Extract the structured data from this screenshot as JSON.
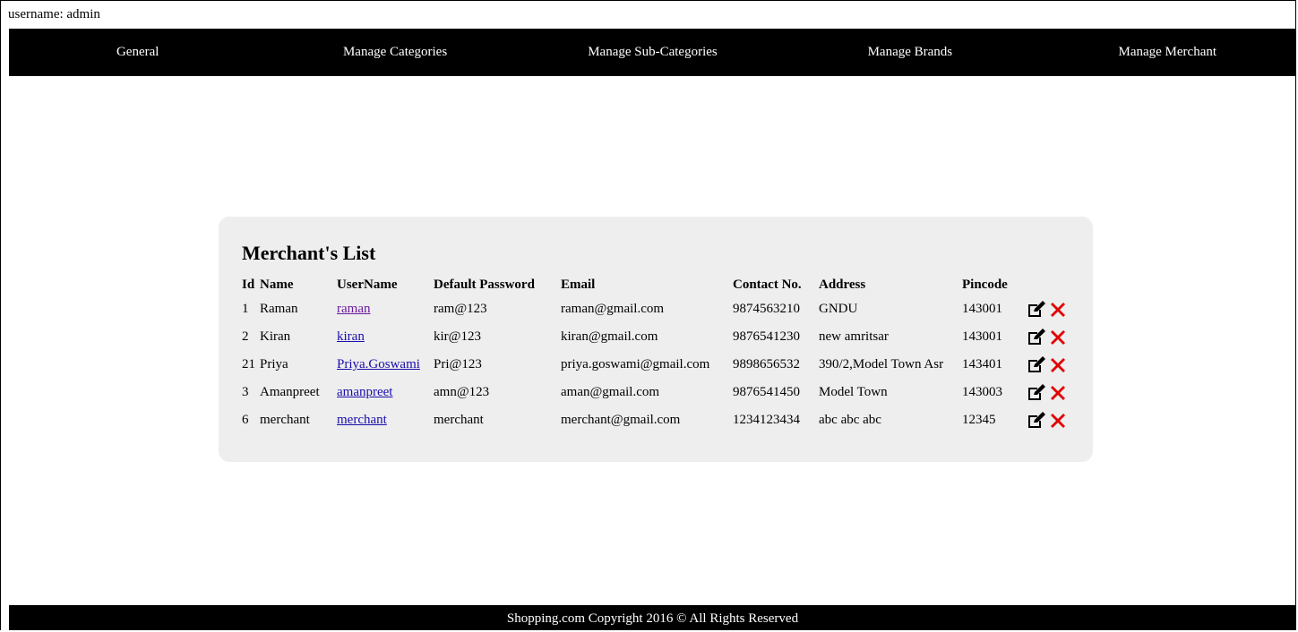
{
  "header": {
    "username_label": "username: admin"
  },
  "nav": {
    "items": [
      {
        "label": "General"
      },
      {
        "label": "Manage Categories"
      },
      {
        "label": "Manage Sub-Categories"
      },
      {
        "label": "Manage Brands"
      },
      {
        "label": "Manage Merchant"
      }
    ]
  },
  "merchants": {
    "title": "Merchant's List",
    "columns": [
      "Id",
      "Name",
      "UserName",
      "Default Password",
      "Email",
      "Contact No.",
      "Address",
      "Pincode"
    ],
    "rows": [
      {
        "id": "1",
        "name": "Raman",
        "username": "raman",
        "password": "ram@123",
        "email": "raman@gmail.com",
        "contact": "9874563210",
        "address": "GNDU",
        "pincode": "143001"
      },
      {
        "id": "2",
        "name": "Kiran",
        "username": "kiran",
        "password": "kir@123",
        "email": "kiran@gmail.com",
        "contact": "9876541230",
        "address": "new amritsar",
        "pincode": "143001"
      },
      {
        "id": "21",
        "name": "Priya",
        "username": "Priya.Goswami",
        "password": "Pri@123",
        "email": "priya.goswami@gmail.com",
        "contact": "9898656532",
        "address": "390/2,Model Town Asr",
        "pincode": "143401"
      },
      {
        "id": "3",
        "name": "Amanpreet",
        "username": "amanpreet",
        "password": "amn@123",
        "email": "aman@gmail.com",
        "contact": "9876541450",
        "address": "Model Town",
        "pincode": "143003"
      },
      {
        "id": "6",
        "name": "merchant",
        "username": "merchant",
        "password": "merchant",
        "email": "merchant@gmail.com",
        "contact": "1234123434",
        "address": "abc abc abc",
        "pincode": "12345"
      }
    ],
    "action_icons": {
      "edit": "edit-icon",
      "delete": "delete-icon"
    },
    "colors": {
      "delete": "#e00000",
      "link": "#1a0dab",
      "visited_link": "#6a1b9a"
    }
  },
  "footer": {
    "text": "Shopping.com Copyright 2016 © All Rights Reserved"
  }
}
